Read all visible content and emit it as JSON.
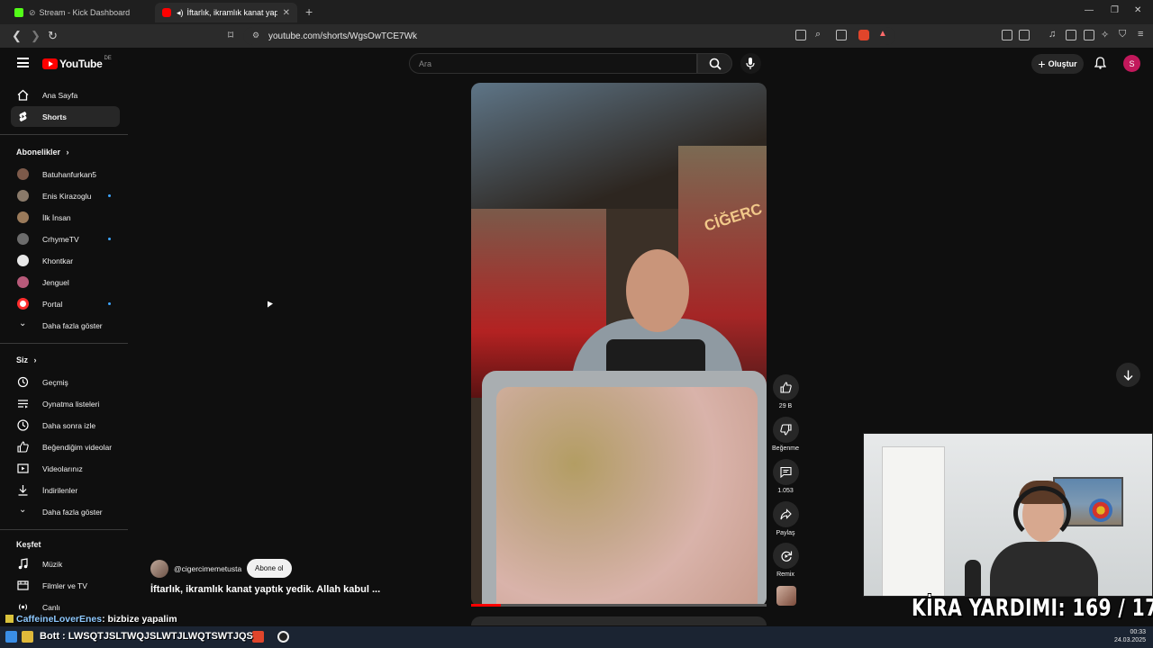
{
  "browser": {
    "tabs": [
      {
        "title": "Stream - Kick Dashboard",
        "favicon": "kick-icon"
      },
      {
        "title": "İftarlık, ikramlık kanat yaptık",
        "favicon": "youtube-icon"
      }
    ],
    "url": "youtube.com/shorts/WgsOwTCE7Wk"
  },
  "header": {
    "logo_text": "YouTube",
    "region": "DE",
    "search_placeholder": "Ara",
    "create_label": "Oluştur",
    "avatar_letter": "S"
  },
  "sidebar": {
    "main": [
      {
        "label": "Ana Sayfa",
        "icon": "home-icon"
      },
      {
        "label": "Shorts",
        "icon": "shorts-icon"
      }
    ],
    "subscriptions_title": "Abonelikler",
    "subscriptions": [
      {
        "label": "Batuhanfurkan5",
        "color": "#7d5a4a",
        "new": false
      },
      {
        "label": "Enis Kirazoglu",
        "color": "#8a7a6a",
        "new": true
      },
      {
        "label": "İlk İnsan",
        "color": "#9a7a5a",
        "new": false
      },
      {
        "label": "CrhymeTV",
        "color": "#6c6c6c",
        "new": true
      },
      {
        "label": "Khontkar",
        "color": "#e8e8e8",
        "new": false
      },
      {
        "label": "Jenguel",
        "color": "#b85a7a",
        "new": false
      },
      {
        "label": "Portal",
        "color": "#ff2d2d",
        "new": true
      }
    ],
    "show_more_1": "Daha fazla göster",
    "you_title": "Siz",
    "you": [
      {
        "label": "Geçmiş",
        "icon": "history-icon"
      },
      {
        "label": "Oynatma listeleri",
        "icon": "playlist-icon"
      },
      {
        "label": "Daha sonra izle",
        "icon": "clock-icon"
      },
      {
        "label": "Beğendiğim videolar",
        "icon": "thumbs-up-icon"
      },
      {
        "label": "Videolarınız",
        "icon": "video-icon"
      },
      {
        "label": "İndirilenler",
        "icon": "download-icon"
      }
    ],
    "show_more_2": "Daha fazla göster",
    "explore_title": "Keşfet",
    "explore": [
      {
        "label": "Müzik",
        "icon": "music-icon"
      },
      {
        "label": "Filmler ve TV",
        "icon": "film-icon"
      },
      {
        "label": "Canlı",
        "icon": "live-icon"
      }
    ]
  },
  "short": {
    "channel": "@cigercimemetusta",
    "subscribe_label": "Abone ol",
    "title": "İftarlık, ikramlık kanat yaptık yedik. Allah kabul ...",
    "sign_text": "CİĞERC",
    "progress": 0.1,
    "actions": {
      "likes": "29 B",
      "dislike_label": "Beğenme",
      "comments": "1.053",
      "share_label": "Paylaş",
      "remix_label": "Remix"
    }
  },
  "overlay": {
    "kira_label": "KİRA YARDIMI:",
    "kira_value": "169 / 170",
    "chat_user": "CaffeineLoverEnes",
    "chat_message": ": bizbize yapalim",
    "bottom_chat": "Bott : LWSQTJSLTWQJSLWTJLWQTSWTJQS"
  },
  "taskbar": {
    "time": "00:33",
    "date": "24.03.2025"
  },
  "colors": {
    "youtube_red": "#ff0000",
    "background": "#0f0f0f",
    "new_dot": "#3ea6ff",
    "avatar": "#c2185b"
  }
}
